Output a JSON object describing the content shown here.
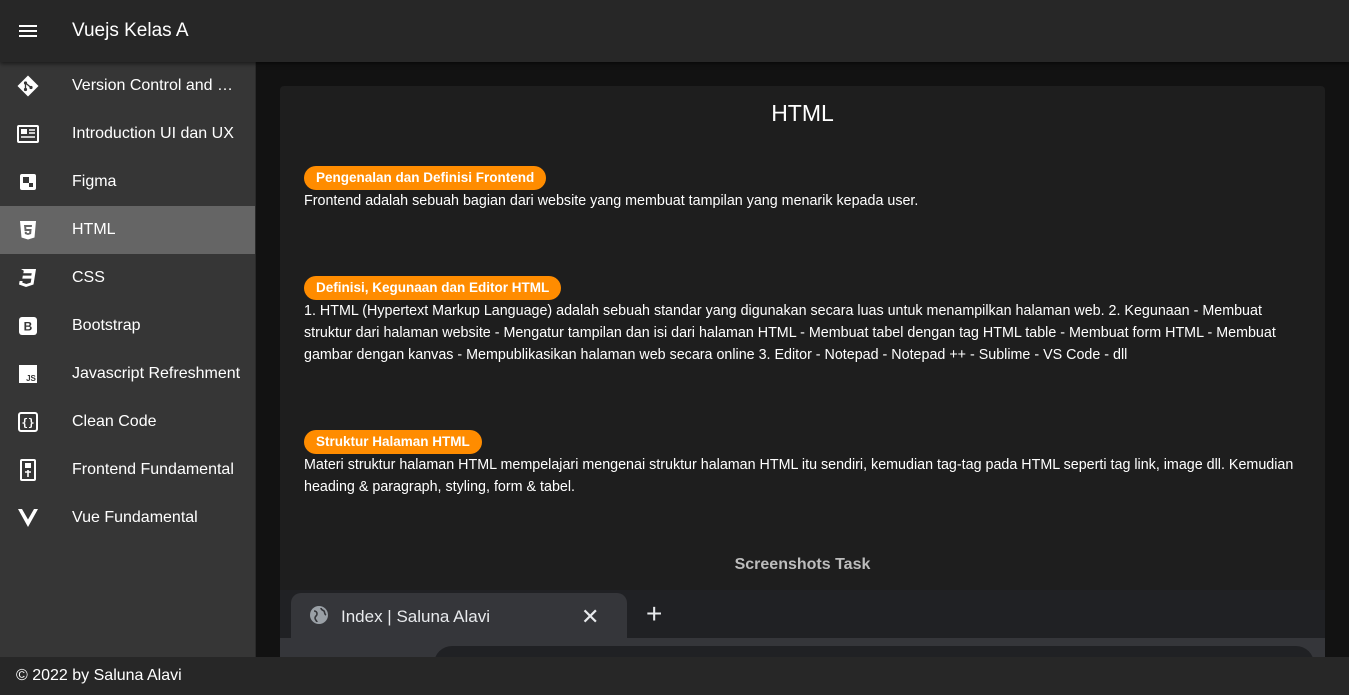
{
  "appbar": {
    "title": "Vuejs Kelas A"
  },
  "sidebar": {
    "items": [
      {
        "label": "Version Control and Branch Management",
        "icon": "git-icon"
      },
      {
        "label": "Introduction UI dan UX",
        "icon": "newspaper-icon"
      },
      {
        "label": "Figma",
        "icon": "figma-icon"
      },
      {
        "label": "HTML",
        "icon": "html5-icon",
        "active": true
      },
      {
        "label": "CSS",
        "icon": "css3-icon"
      },
      {
        "label": "Bootstrap",
        "icon": "bootstrap-icon"
      },
      {
        "label": "Javascript Refreshment",
        "icon": "javascript-icon"
      },
      {
        "label": "Clean Code",
        "icon": "code-braces-icon"
      },
      {
        "label": "Frontend Fundamental",
        "icon": "file-document-icon"
      },
      {
        "label": "Vue Fundamental",
        "icon": "vuejs-icon"
      }
    ]
  },
  "main": {
    "title": "HTML",
    "sections": [
      {
        "chip": "Pengenalan dan Definisi Frontend",
        "text": "Frontend adalah sebuah bagian dari website yang membuat tampilan yang menarik kepada user."
      },
      {
        "chip": "Definisi, Kegunaan dan Editor HTML",
        "text": "1. HTML (Hypertext Markup Language) adalah sebuah standar yang digunakan secara luas untuk menampilkan halaman web. 2. Kegunaan - Membuat struktur dari halaman website - Mengatur tampilan dan isi dari halaman HTML - Membuat tabel dengan tag HTML table - Membuat form HTML - Membuat gambar dengan kanvas - Mempublikasikan halaman web secara online 3. Editor - Notepad - Notepad ++ - Sublime - VS Code - dll"
      },
      {
        "chip": "Struktur Halaman HTML",
        "text": "Materi struktur halaman HTML mempelajari mengenai struktur halaman HTML itu sendiri, kemudian tag-tag pada HTML seperti tag link, image dll. Kemudian heading & paragraph, styling, form & tabel."
      }
    ],
    "screenshots_title": "Screenshots Task",
    "screenshot": {
      "tab_title": "Index | Saluna Alavi",
      "close_glyph": "✕",
      "newtab_glyph": "+"
    }
  },
  "footer": {
    "text": "© 2022 by Saluna Alavi"
  },
  "colors": {
    "chip": "#ff8c00",
    "active_nav": "#656565",
    "appbar": "#272727",
    "sidebar": "#363636"
  }
}
